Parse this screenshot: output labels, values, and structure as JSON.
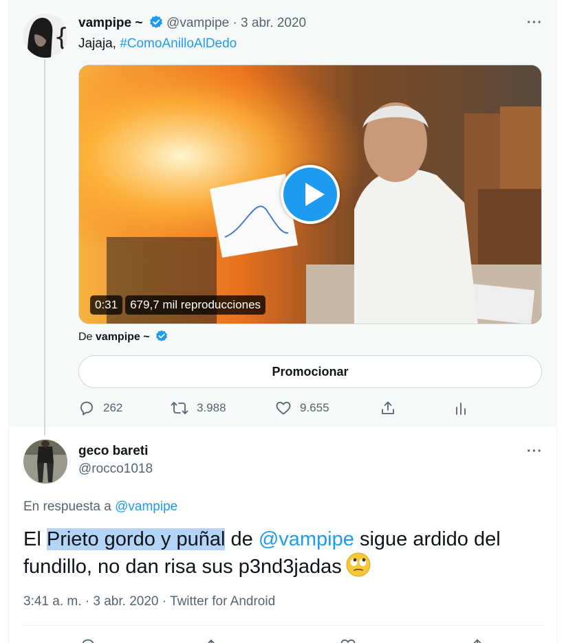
{
  "colors": {
    "accent": "#1d9bf0",
    "muted": "#536471",
    "text": "#0f1419",
    "highlight": "#b3d3f7"
  },
  "parent_tweet": {
    "author_name": "vampipe ~",
    "handle": "@vampipe",
    "separator": "·",
    "date": "3 abr. 2020",
    "text_prefix": "Jajaja,",
    "hashtag": "#ComoAnilloAlDedo",
    "video": {
      "duration": "0:31",
      "views": "679,7 mil reproducciones"
    },
    "from_prefix": "De",
    "from_name": "vampipe ~",
    "promote_label": "Promocionar",
    "replies": "262",
    "retweets": "3.988",
    "likes": "9.655"
  },
  "reply_tweet": {
    "author_name": "geco bareti",
    "handle": "@rocco1018",
    "reply_prefix": "En respuesta a",
    "reply_to": "@vampipe",
    "text_start": "El",
    "text_highlight": "Prieto gordo y puñal",
    "text_de": "de",
    "mention": "@vampipe",
    "text_end": "sigue ardido del fundillo, no dan risa sus p3nd3jadas",
    "time": "3:41 a. m.",
    "date": "3 abr. 2020",
    "source": "Twitter for Android",
    "separator": "·"
  },
  "icons": [
    "verified-icon",
    "more-icon",
    "play-icon",
    "reply-icon",
    "retweet-icon",
    "like-icon",
    "share-icon",
    "analytics-icon",
    "eye-roll-emoji"
  ]
}
